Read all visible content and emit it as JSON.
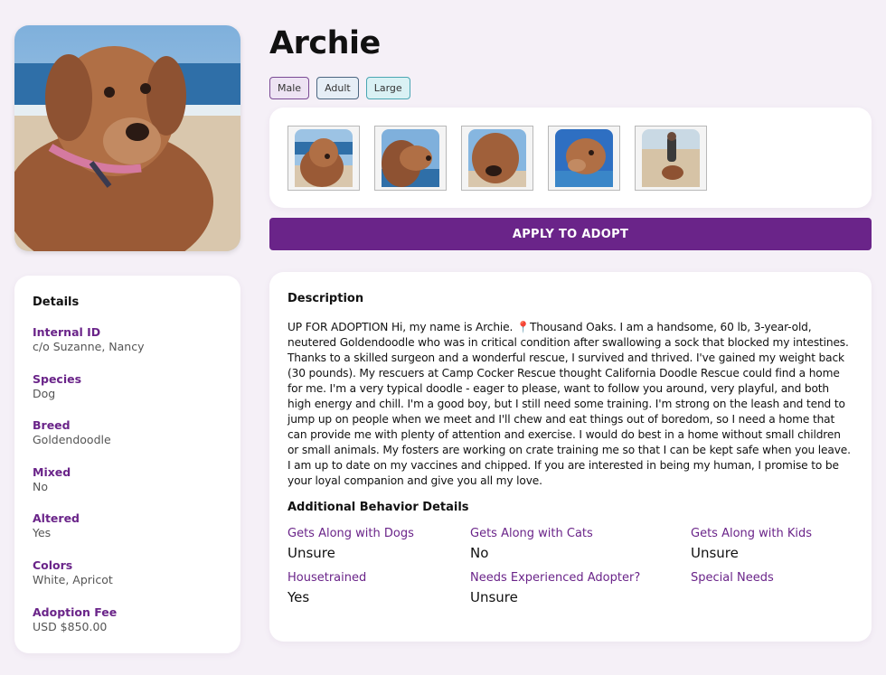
{
  "pet": {
    "name": "Archie",
    "tags": [
      "Male",
      "Adult",
      "Large"
    ]
  },
  "gallery": {
    "thumbnail_count": 5
  },
  "apply_button": "APPLY TO ADOPT",
  "details": {
    "title": "Details",
    "items": [
      {
        "label": "Internal ID",
        "value": "c/o Suzanne, Nancy"
      },
      {
        "label": "Species",
        "value": "Dog"
      },
      {
        "label": "Breed",
        "value": "Goldendoodle"
      },
      {
        "label": "Mixed",
        "value": "No"
      },
      {
        "label": "Altered",
        "value": "Yes"
      },
      {
        "label": "Colors",
        "value": "White, Apricot"
      },
      {
        "label": "Adoption Fee",
        "value": "USD $850.00"
      }
    ]
  },
  "description": {
    "title": "Description",
    "text": "UP FOR ADOPTION Hi, my name is Archie. 📍Thousand Oaks. I am a handsome, 60 lb, 3-year-old, neutered Goldendoodle who was in critical condition after swallowing a sock that blocked my intestines. Thanks to a skilled surgeon and a wonderful rescue, I survived and thrived. I've gained my weight back (30 pounds). My rescuers at Camp Cocker Rescue thought California Doodle Rescue could find a home for me. I'm a very typical doodle - eager to please, want to follow you around, very playful, and both high energy and chill. I'm a good boy, but I still need some training. I'm strong on the leash and tend to jump up on people when we meet and I'll chew and eat things out of boredom, so I need a home that can provide me with plenty of attention and exercise. I would do best in a home without small children or small animals. My fosters are working on crate training me so that I can be kept safe when you leave. I am up to date on my vaccines and chipped. If you are interested in being my human, I promise to be your loyal companion and give you all my love."
  },
  "behavior": {
    "title": "Additional Behavior Details",
    "items": [
      {
        "label": "Gets Along with Dogs",
        "value": "Unsure"
      },
      {
        "label": "Gets Along with Cats",
        "value": "No"
      },
      {
        "label": "Gets Along with Kids",
        "value": "Unsure"
      },
      {
        "label": "Housetrained",
        "value": "Yes"
      },
      {
        "label": "Needs Experienced Adopter?",
        "value": "Unsure"
      },
      {
        "label": "Special Needs",
        "value": ""
      }
    ]
  },
  "colors": {
    "accent": "#6a2489",
    "background": "#f5f0f7"
  }
}
